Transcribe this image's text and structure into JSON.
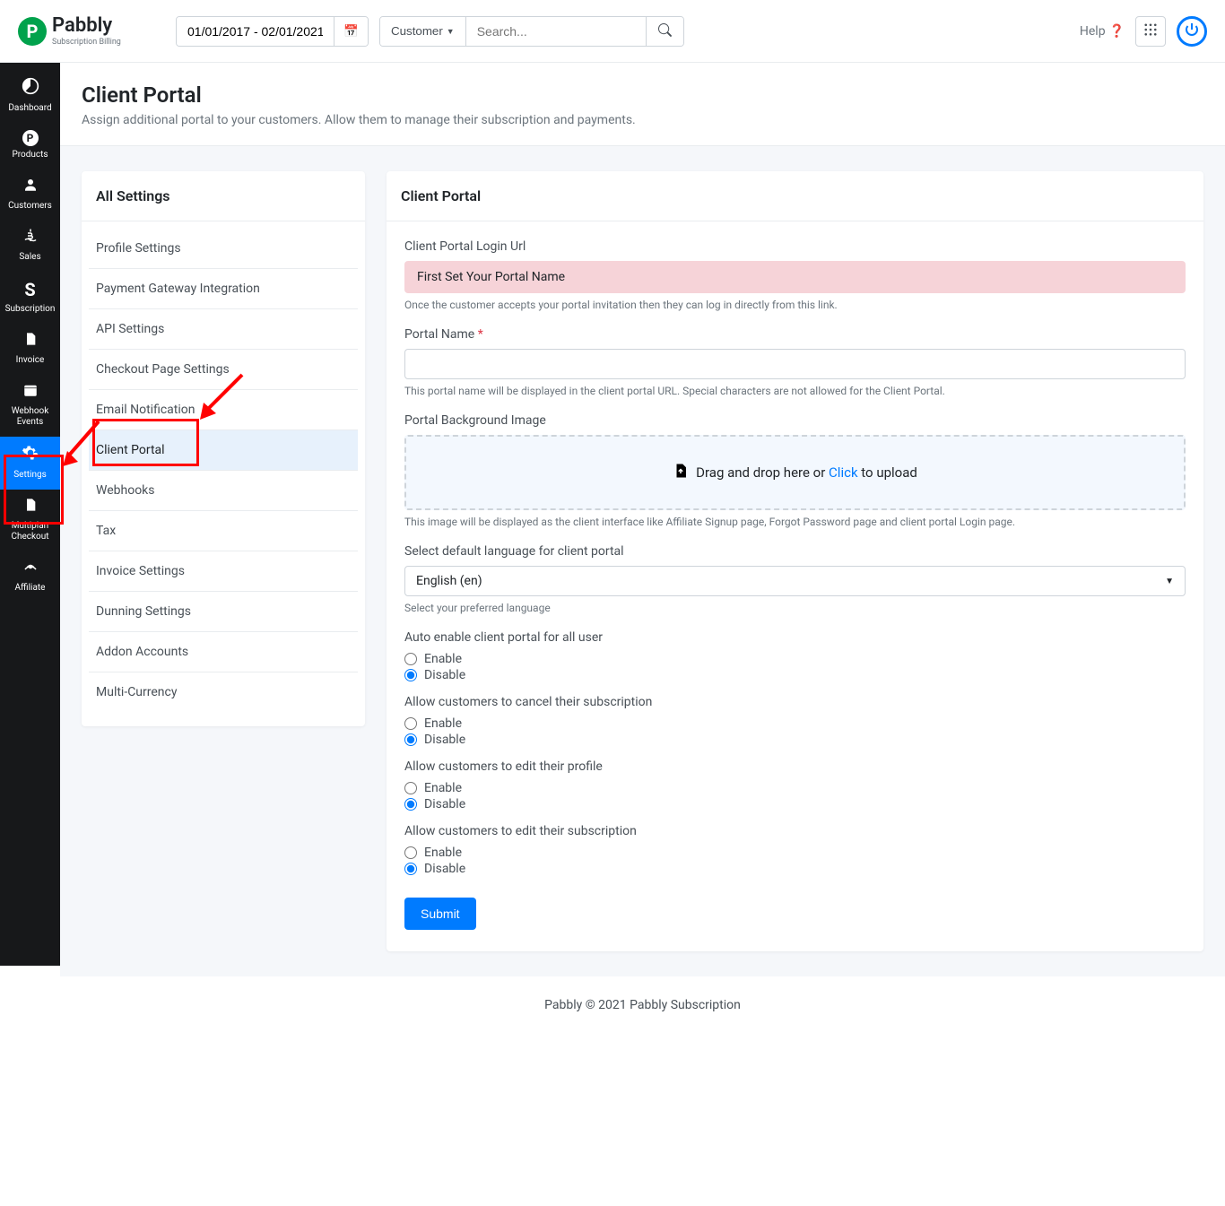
{
  "header": {
    "brand_name": "Pabbly",
    "brand_sub": "Subscription Billing",
    "date_range": "01/01/2017 - 02/01/2021",
    "customer_label": "Customer",
    "search_placeholder": "Search...",
    "help_label": "Help"
  },
  "sidebar": {
    "items": [
      {
        "label": "Dashboard",
        "icon": "◔"
      },
      {
        "label": "Products",
        "icon": "P"
      },
      {
        "label": "Customers",
        "icon": "👤"
      },
      {
        "label": "Sales",
        "icon": "$"
      },
      {
        "label": "Subscription",
        "icon": "S"
      },
      {
        "label": "Invoice",
        "icon": "📄"
      },
      {
        "label": "Webhook Events",
        "icon": "📅"
      },
      {
        "label": "Settings",
        "icon": "⚙"
      },
      {
        "label": "Multiplan Checkout",
        "icon": "📋"
      },
      {
        "label": "Affiliate",
        "icon": "📡"
      }
    ]
  },
  "page": {
    "title": "Client Portal",
    "desc": "Assign additional portal to your customers. Allow them to manage their subscription and payments."
  },
  "settings_panel": {
    "title": "All Settings",
    "items": [
      "Profile Settings",
      "Payment Gateway Integration",
      "API Settings",
      "Checkout Page Settings",
      "Email Notification",
      "Client Portal",
      "Webhooks",
      "Tax",
      "Invoice Settings",
      "Dunning Settings",
      "Addon Accounts",
      "Multi-Currency"
    ]
  },
  "form": {
    "title": "Client Portal",
    "login_url_label": "Client Portal Login Url",
    "login_url_alert": "First Set Your Portal Name",
    "login_url_help": "Once the customer accepts your portal invitation then they can log in directly from this link.",
    "portal_name_label": "Portal Name",
    "portal_name_help": "This portal name will be displayed in the client portal URL. Special characters are not allowed for the Client Portal.",
    "bg_label": "Portal Background Image",
    "drop_pre": "Drag and drop here or",
    "drop_click": "Click",
    "drop_post": "to upload",
    "bg_help": "This image will be displayed as the client interface like Affiliate Signup page, Forgot Password page and client portal Login page.",
    "lang_label": "Select default language for client portal",
    "lang_value": "English (en)",
    "lang_help": "Select your preferred language",
    "auto_enable_label": "Auto enable client portal for all user",
    "cancel_sub_label": "Allow customers to cancel their subscription",
    "edit_profile_label": "Allow customers to edit their profile",
    "edit_sub_label": "Allow customers to edit their subscription",
    "enable": "Enable",
    "disable": "Disable",
    "submit": "Submit"
  },
  "footer": "Pabbly © 2021 Pabbly Subscription"
}
